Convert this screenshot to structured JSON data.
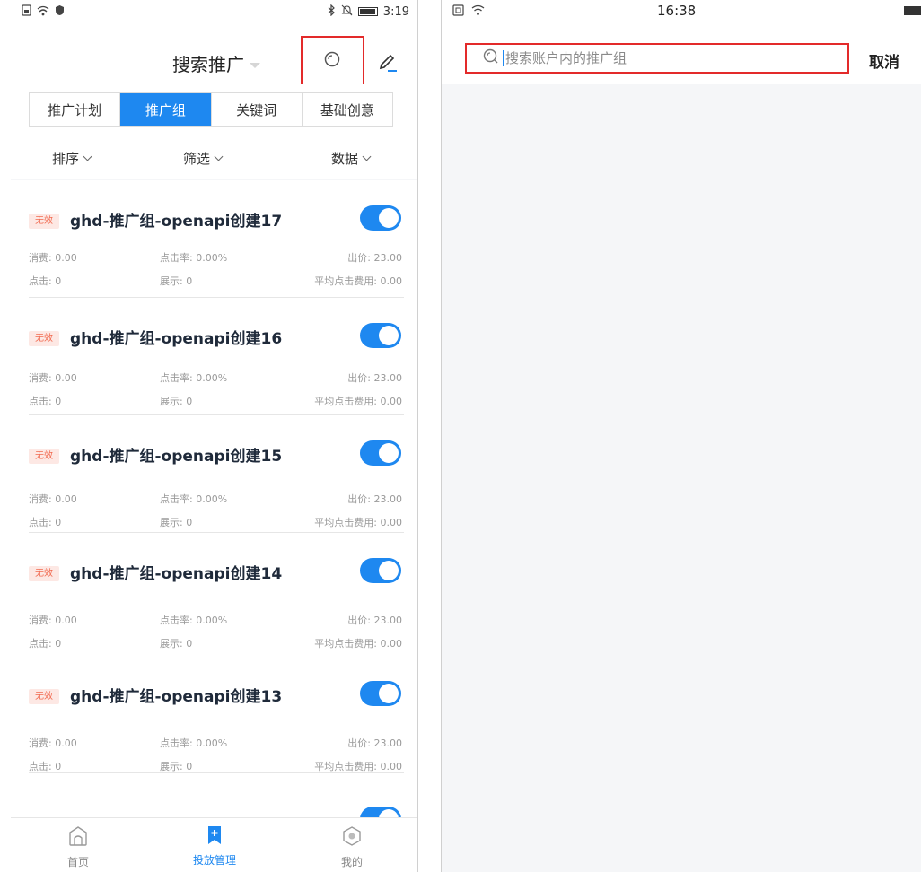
{
  "left": {
    "status_bar": {
      "time": "3:19",
      "icons_left": [
        "sim-icon",
        "wifi-icon",
        "shield-icon"
      ],
      "icons_right": [
        "bluetooth-icon",
        "mute-icon",
        "battery-icon"
      ]
    },
    "header": {
      "title": "搜索推广"
    },
    "tabs": [
      {
        "label": "推广计划",
        "active": false
      },
      {
        "label": "推广组",
        "active": true
      },
      {
        "label": "关键词",
        "active": false
      },
      {
        "label": "基础创意",
        "active": false
      }
    ],
    "filters": {
      "sort": "排序",
      "filter": "筛选",
      "data": "数据"
    },
    "cards": [
      {
        "badge": "无效",
        "name": "ghd-推广组-openapi创建17",
        "spend": "消费: 0.00",
        "ctr": "点击率: 0.00%",
        "bid": "出价: 23.00",
        "clicks": "点击: 0",
        "impressions": "展示: 0",
        "cpc": "平均点击费用: 0.00",
        "enabled": true
      },
      {
        "badge": "无效",
        "name": "ghd-推广组-openapi创建16",
        "spend": "消费: 0.00",
        "ctr": "点击率: 0.00%",
        "bid": "出价: 23.00",
        "clicks": "点击: 0",
        "impressions": "展示: 0",
        "cpc": "平均点击费用: 0.00",
        "enabled": true
      },
      {
        "badge": "无效",
        "name": "ghd-推广组-openapi创建15",
        "spend": "消费: 0.00",
        "ctr": "点击率: 0.00%",
        "bid": "出价: 23.00",
        "clicks": "点击: 0",
        "impressions": "展示: 0",
        "cpc": "平均点击费用: 0.00",
        "enabled": true
      },
      {
        "badge": "无效",
        "name": "ghd-推广组-openapi创建14",
        "spend": "消费: 0.00",
        "ctr": "点击率: 0.00%",
        "bid": "出价: 23.00",
        "clicks": "点击: 0",
        "impressions": "展示: 0",
        "cpc": "平均点击费用: 0.00",
        "enabled": true
      },
      {
        "badge": "无效",
        "name": "ghd-推广组-openapi创建13",
        "spend": "消费: 0.00",
        "ctr": "点击率: 0.00%",
        "bid": "出价: 23.00",
        "clicks": "点击: 0",
        "impressions": "展示: 0",
        "cpc": "平均点击费用: 0.00",
        "enabled": true
      }
    ],
    "nav": [
      {
        "label": "首页",
        "icon": "home-icon",
        "active": false
      },
      {
        "label": "投放管理",
        "icon": "bookmark-plus-icon",
        "active": true
      },
      {
        "label": "我的",
        "icon": "profile-icon",
        "active": false
      }
    ]
  },
  "right": {
    "status_bar": {
      "time": "16:38",
      "icons_left": [
        "sim-icon",
        "wifi-icon"
      ],
      "icons_right": [
        "battery-icon"
      ]
    },
    "search": {
      "placeholder": "搜索账户内的推广组",
      "value": ""
    },
    "cancel_label": "取消"
  },
  "colors": {
    "accent": "#1e88f0",
    "highlight_box": "#e32a2a",
    "badge_bg": "#fde8e4",
    "badge_text": "#f16a50"
  }
}
